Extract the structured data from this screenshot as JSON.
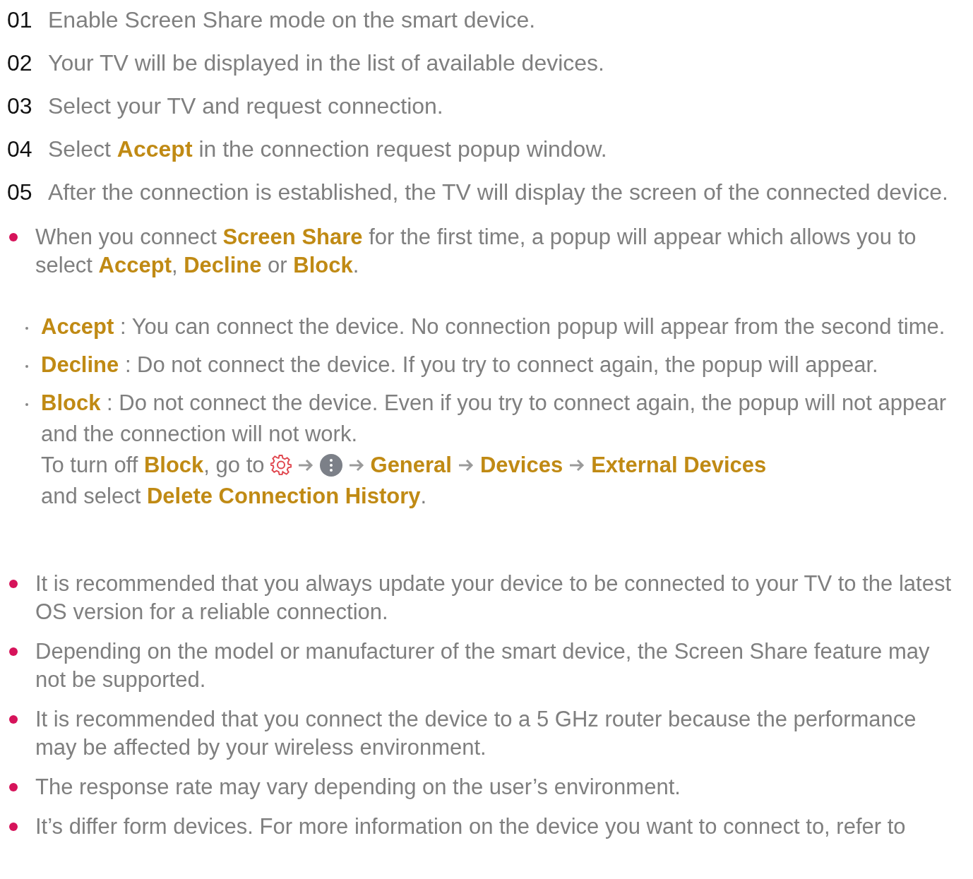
{
  "steps": [
    {
      "number": "01",
      "text": "Enable Screen Share mode on the smart device."
    },
    {
      "number": "02",
      "text": "Your TV will be displayed in the list of available devices."
    },
    {
      "number": "03",
      "text": "Select your TV and request connection."
    },
    {
      "number": "04",
      "text": "Select **Accept** in the connection request popup window."
    },
    {
      "number": "05",
      "text": "After the connection is established, the TV will display the screen of the connected device."
    }
  ],
  "notes": [
    {
      "text": "When you connect **Screen Share** for the first time, a popup will appear which allows you to select **Accept**, **Decline** or **Block**.",
      "options": [
        {
          "term": "Accept",
          "text": ": You can connect the device. No connection popup will appear from the second time."
        },
        {
          "term": "Decline",
          "text": ": Do not connect the device. If you try to connect again, the popup will appear."
        },
        {
          "term": "Block",
          "text": ": Do not connect the device. Even if you try to connect again, the popup will not appear and the connection will not work.",
          "path": {
            "lead": "To turn off **Block**, go to",
            "steps": [
              "General",
              "Devices",
              "External Devices"
            ],
            "tail": "and select **Delete Connection History**."
          }
        }
      ]
    },
    {
      "text": "It is recommended that you always update your device to be connected to your TV to the latest OS version for a reliable connection."
    },
    {
      "text": "Depending on the model or manufacturer of the smart device, the Screen Share feature may not be supported."
    },
    {
      "text": "It is recommended that you connect the device to a 5 GHz router because the performance may be affected by your wireless environment."
    },
    {
      "text": "The response rate may vary depending on the user’s environment."
    },
    {
      "text": "It’s differ form devices. For more information on the device you want to connect to, refer to"
    }
  ]
}
